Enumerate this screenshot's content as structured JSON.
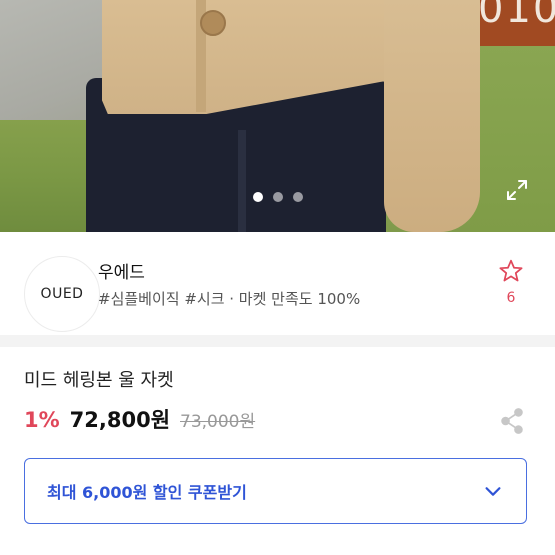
{
  "photo": {
    "sign_text": "010",
    "slide_count": 3,
    "active_slide": 1
  },
  "shop": {
    "logo_text": "OUED",
    "name": "우에드",
    "meta": "#심플베이직 #시크 · 마켓 만족도 100%",
    "favorites_count": "6",
    "favorite_icon": "star-outline-icon"
  },
  "product": {
    "title": "미드 헤링본 울 자켓",
    "discount": "1%",
    "price": "72,800원",
    "original_price": "73,000원"
  },
  "coupon": {
    "label": "최대 6,000원 할인 쿠폰받기",
    "icon": "chevron-down-icon"
  },
  "colors": {
    "accent_red": "#e0475a",
    "accent_blue": "#2f54d6"
  }
}
